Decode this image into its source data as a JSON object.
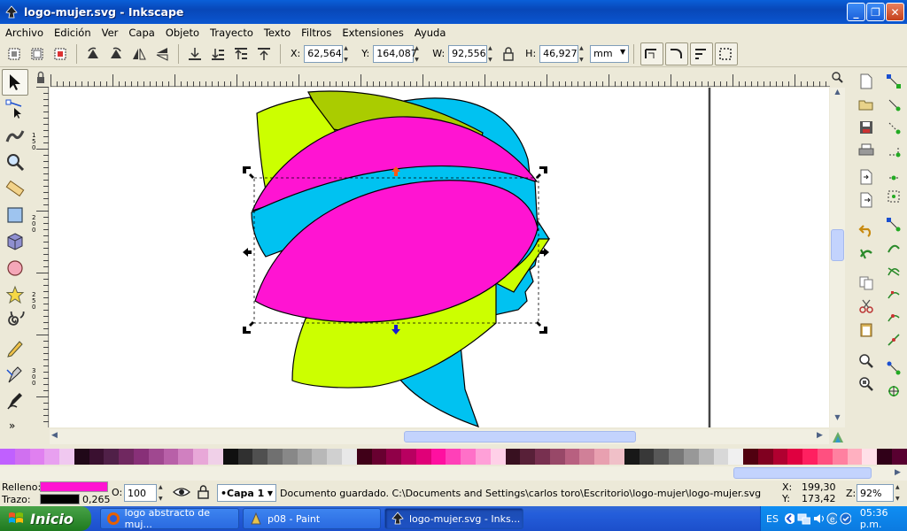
{
  "window": {
    "title": "logo-mujer.svg - Inkscape",
    "minimize": "_",
    "maximize": "❐",
    "close": "✕"
  },
  "menu": [
    "Archivo",
    "Edición",
    "Ver",
    "Capa",
    "Objeto",
    "Trayecto",
    "Texto",
    "Filtros",
    "Extensiones",
    "Ayuda"
  ],
  "toolbar": {
    "x_label": "X:",
    "x_value": "62,564",
    "y_label": "Y:",
    "y_value": "164,087",
    "w_label": "W:",
    "w_value": "92,556",
    "h_label": "H:",
    "h_value": "46,927",
    "unit": "mm"
  },
  "tools": [
    "selector-tool",
    "node-tool",
    "tweak-tool",
    "zoom-tool",
    "measure-tool",
    "rectangle-tool",
    "3d-box-tool",
    "ellipse-tool",
    "star-tool",
    "spiral-tool",
    "pencil-tool",
    "pen-tool",
    "calligraphy-tool"
  ],
  "tools_more": "»",
  "ruler_v_labels": [
    "1",
    "5",
    "0",
    "2",
    "0",
    "0",
    "2",
    "5",
    "0",
    "3",
    "0",
    "0"
  ],
  "palette": [
    "#c060ff",
    "#d070f0",
    "#e080f0",
    "#e8a0f0",
    "#f0c8f0",
    "#200818",
    "#3a1030",
    "#502048",
    "#702860",
    "#883078",
    "#a04890",
    "#b860a8",
    "#d080c0",
    "#e8a8d8",
    "#f0d0e8",
    "#101010",
    "#303030",
    "#505050",
    "#707070",
    "#888888",
    "#a0a0a0",
    "#b8b8b8",
    "#d0d0d0",
    "#e8e8e8",
    "#400018",
    "#680030",
    "#900048",
    "#b80060",
    "#e00078",
    "#ff10a0",
    "#ff40b8",
    "#ff70c8",
    "#ffa0d8",
    "#ffd0e8",
    "#381020",
    "#582038",
    "#783050",
    "#984868",
    "#b86080",
    "#d08098",
    "#e8a0b0",
    "#f0c0c8",
    "#181818",
    "#383838",
    "#585858",
    "#787878",
    "#989898",
    "#b8b8b8",
    "#d8d8d8",
    "#f0f0f0",
    "#500010",
    "#800020",
    "#b00030",
    "#e00040",
    "#ff2060",
    "#ff5080",
    "#ff80a0",
    "#ffb0c0",
    "#ffe0e8",
    "#300018",
    "#580030"
  ],
  "status": {
    "fill_label": "Relleno:",
    "fill_color": "#ff14d2",
    "stroke_label": "Trazo:",
    "stroke_color": "#000000",
    "stroke_width": "0,265",
    "opacity_label": "O:",
    "opacity": "100",
    "layer": "•Capa 1",
    "message": "Documento guardado. C:\\Documents and Settings\\carlos toro\\Escritorio\\logo-mujer\\logo-mujer.svg",
    "cursor_x_label": "X:",
    "cursor_x": "199,30",
    "cursor_y_label": "Y:",
    "cursor_y": "173,42",
    "zoom_label": "Z:",
    "zoom": "92%"
  },
  "taskbar": {
    "start": "Inicio",
    "tasks": [
      "logo abstracto de muj...",
      "p08 - Paint",
      "logo-mujer.svg - Inks..."
    ],
    "lang": "ES",
    "time": "05:36 p.m."
  }
}
